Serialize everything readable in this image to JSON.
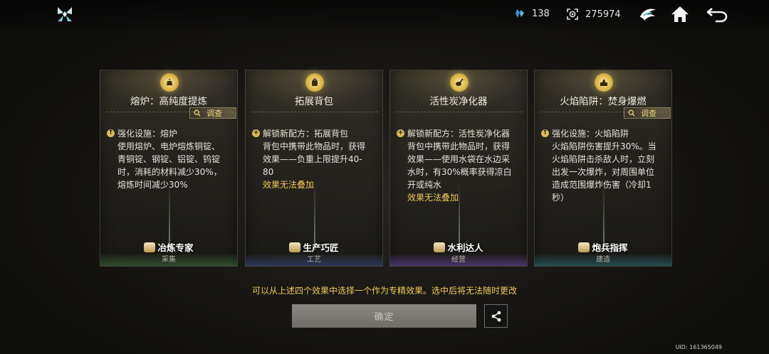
{
  "topbar": {
    "currency1": {
      "value": "138",
      "icon": "crystal-icon"
    },
    "currency2": {
      "value": "275974",
      "icon": "coin-frame-icon"
    }
  },
  "cards": [
    {
      "title": "熔炉：高纯度提炼",
      "inspect_label": "调查",
      "show_inspect": true,
      "desc_head": "强化设施：熔炉",
      "desc_body": [
        "使用熔炉、电炉熔炼铜锭、",
        "青铜锭、钢锭、铝锭、钨锭",
        "时，消耗的材料减少30%，",
        "熔炼时间减少30%"
      ],
      "note": "",
      "badge": "冶炼专家",
      "category": "采集"
    },
    {
      "title": "拓展背包",
      "inspect_label": "",
      "show_inspect": false,
      "desc_head": "解锁新配方：拓展背包",
      "desc_body": [
        "背包中携带此物品时，获得",
        "效果——负重上限提升40-",
        "80"
      ],
      "note": "效果无法叠加",
      "badge": "生产巧匠",
      "category": "工艺"
    },
    {
      "title": "活性炭净化器",
      "inspect_label": "",
      "show_inspect": false,
      "desc_head": "解锁新配方：活性炭净化器",
      "desc_body": [
        "背包中携带此物品时，获得",
        "效果——使用水袋在水边采",
        "水时，有30%概率获得凉白",
        "开或纯水"
      ],
      "note": "效果无法叠加",
      "badge": "水利达人",
      "category": "经营"
    },
    {
      "title": "火焰陷阱：焚身爆燃",
      "inspect_label": "调查",
      "show_inspect": true,
      "desc_head": "强化设施：火焰陷阱",
      "desc_body": [
        "火焰陷阱伤害提升30%。当",
        "火焰陷阱击杀敌人时，立刻",
        "出发一次爆炸，对周围单位",
        "造成范围爆炸伤害（冷却1",
        "秒）"
      ],
      "note": "",
      "badge": "炮兵指挥",
      "category": "建造"
    }
  ],
  "hint": "可以从上述四个效果中选择一个作为专精效果。选中后将无法随时更改",
  "confirm_label": "确定",
  "uid": "UID: 161365049"
}
